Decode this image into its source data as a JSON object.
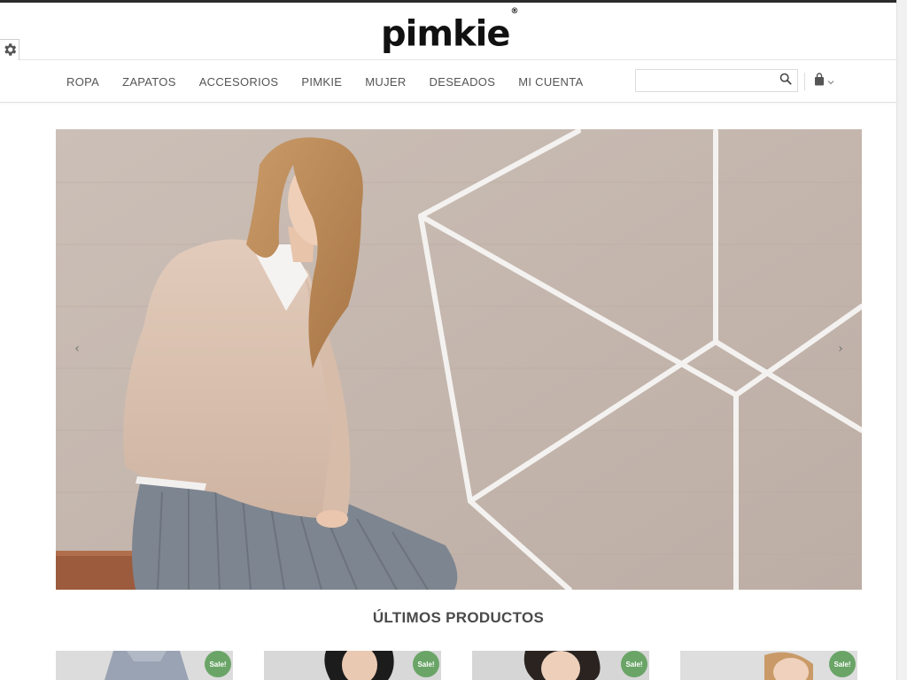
{
  "header": {
    "logo_text": "pimkie",
    "logo_mark": "®"
  },
  "nav": {
    "items": [
      {
        "label": "ROPA"
      },
      {
        "label": "ZAPATOS"
      },
      {
        "label": "ACCESORIOS"
      },
      {
        "label": "PIMKIE"
      },
      {
        "label": "MUJER"
      },
      {
        "label": "DESEADOS"
      },
      {
        "label": "MI CUENTA"
      }
    ]
  },
  "search": {
    "placeholder": "",
    "value": ""
  },
  "icons": {
    "settings": "gear-icon",
    "search": "search-icon",
    "cart": "shopping-bag-icon",
    "cart_dropdown": "chevron-down-icon",
    "slider_prev": "chevron-left-icon",
    "slider_next": "chevron-right-icon"
  },
  "slider": {
    "prev": "‹",
    "next": "›"
  },
  "latest": {
    "title": "ÚLTIMOS PRODUCTOS",
    "products": [
      {
        "badge": "Sale!"
      },
      {
        "badge": "Sale!"
      },
      {
        "badge": "Sale!"
      },
      {
        "badge": "Sale!"
      }
    ]
  },
  "colors": {
    "sale_badge": "#6aa567",
    "nav_text": "#555555",
    "logo": "#111111"
  }
}
